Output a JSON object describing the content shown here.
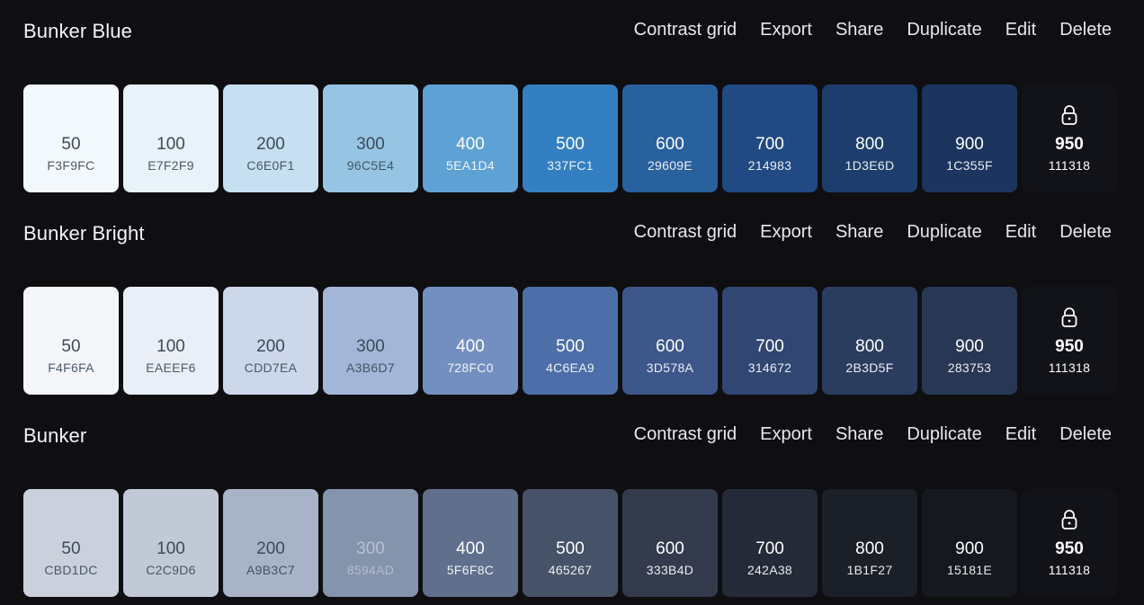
{
  "actions": [
    "Contrast grid",
    "Export",
    "Share",
    "Duplicate",
    "Edit",
    "Delete"
  ],
  "palettes": [
    {
      "name": "Bunker Blue",
      "swatches": [
        {
          "shade": "50",
          "hex": "F3F9FC",
          "bg": "#F3F9FC",
          "fg": "#3b4a5a"
        },
        {
          "shade": "100",
          "hex": "E7F2F9",
          "bg": "#E7F2F9",
          "fg": "#3b4a5a"
        },
        {
          "shade": "200",
          "hex": "C6E0F1",
          "bg": "#C6E0F1",
          "fg": "#3b4a5a"
        },
        {
          "shade": "300",
          "hex": "96C5E4",
          "bg": "#96C5E4",
          "fg": "#3b4a5a"
        },
        {
          "shade": "400",
          "hex": "5EA1D4",
          "bg": "#5EA1D4",
          "fg": "#ffffff"
        },
        {
          "shade": "500",
          "hex": "337FC1",
          "bg": "#337FC1",
          "fg": "#ffffff"
        },
        {
          "shade": "600",
          "hex": "29609E",
          "bg": "#29609E",
          "fg": "#ffffff"
        },
        {
          "shade": "700",
          "hex": "214983",
          "bg": "#214983",
          "fg": "#ffffff"
        },
        {
          "shade": "800",
          "hex": "1D3E6D",
          "bg": "#1D3E6D",
          "fg": "#ffffff"
        },
        {
          "shade": "900",
          "hex": "1C355F",
          "bg": "#1C355F",
          "fg": "#ffffff"
        },
        {
          "shade": "950",
          "hex": "111318",
          "bg": "#111318",
          "fg": "#ffffff",
          "locked": true
        }
      ]
    },
    {
      "name": "Bunker Bright",
      "swatches": [
        {
          "shade": "50",
          "hex": "F4F6FA",
          "bg": "#F4F6FA",
          "fg": "#3b4a5a"
        },
        {
          "shade": "100",
          "hex": "EAEEF6",
          "bg": "#EAEEF6",
          "fg": "#3b4a5a"
        },
        {
          "shade": "200",
          "hex": "CDD7EA",
          "bg": "#CDD7EA",
          "fg": "#3b4a5a"
        },
        {
          "shade": "300",
          "hex": "A3B6D7",
          "bg": "#A3B6D7",
          "fg": "#3b4a5a"
        },
        {
          "shade": "400",
          "hex": "728FC0",
          "bg": "#728FC0",
          "fg": "#ffffff"
        },
        {
          "shade": "500",
          "hex": "4C6EA9",
          "bg": "#4C6EA9",
          "fg": "#ffffff"
        },
        {
          "shade": "600",
          "hex": "3D578A",
          "bg": "#3D578A",
          "fg": "#ffffff"
        },
        {
          "shade": "700",
          "hex": "314672",
          "bg": "#314672",
          "fg": "#ffffff"
        },
        {
          "shade": "800",
          "hex": "2B3D5F",
          "bg": "#2B3D5F",
          "fg": "#ffffff"
        },
        {
          "shade": "900",
          "hex": "283753",
          "bg": "#283753",
          "fg": "#ffffff"
        },
        {
          "shade": "950",
          "hex": "111318",
          "bg": "#111318",
          "fg": "#ffffff",
          "locked": true
        }
      ]
    },
    {
      "name": "Bunker",
      "swatches": [
        {
          "shade": "50",
          "hex": "CBD1DC",
          "bg": "#CBD1DC",
          "fg": "#3b4a5a"
        },
        {
          "shade": "100",
          "hex": "C2C9D6",
          "bg": "#C2C9D6",
          "fg": "#3b4a5a"
        },
        {
          "shade": "200",
          "hex": "A9B3C7",
          "bg": "#A9B3C7",
          "fg": "#3b4a5a"
        },
        {
          "shade": "300",
          "hex": "8594AD",
          "bg": "#8594AD",
          "fg": "#b7c0cf"
        },
        {
          "shade": "400",
          "hex": "5F6F8C",
          "bg": "#5F6F8C",
          "fg": "#ffffff"
        },
        {
          "shade": "500",
          "hex": "465267",
          "bg": "#465267",
          "fg": "#ffffff"
        },
        {
          "shade": "600",
          "hex": "333B4D",
          "bg": "#333B4D",
          "fg": "#ffffff"
        },
        {
          "shade": "700",
          "hex": "242A38",
          "bg": "#242A38",
          "fg": "#ffffff"
        },
        {
          "shade": "800",
          "hex": "1B1F27",
          "bg": "#1B1F27",
          "fg": "#ffffff"
        },
        {
          "shade": "900",
          "hex": "15181E",
          "bg": "#15181E",
          "fg": "#ffffff"
        },
        {
          "shade": "950",
          "hex": "111318",
          "bg": "#111318",
          "fg": "#ffffff",
          "locked": true
        }
      ]
    }
  ]
}
